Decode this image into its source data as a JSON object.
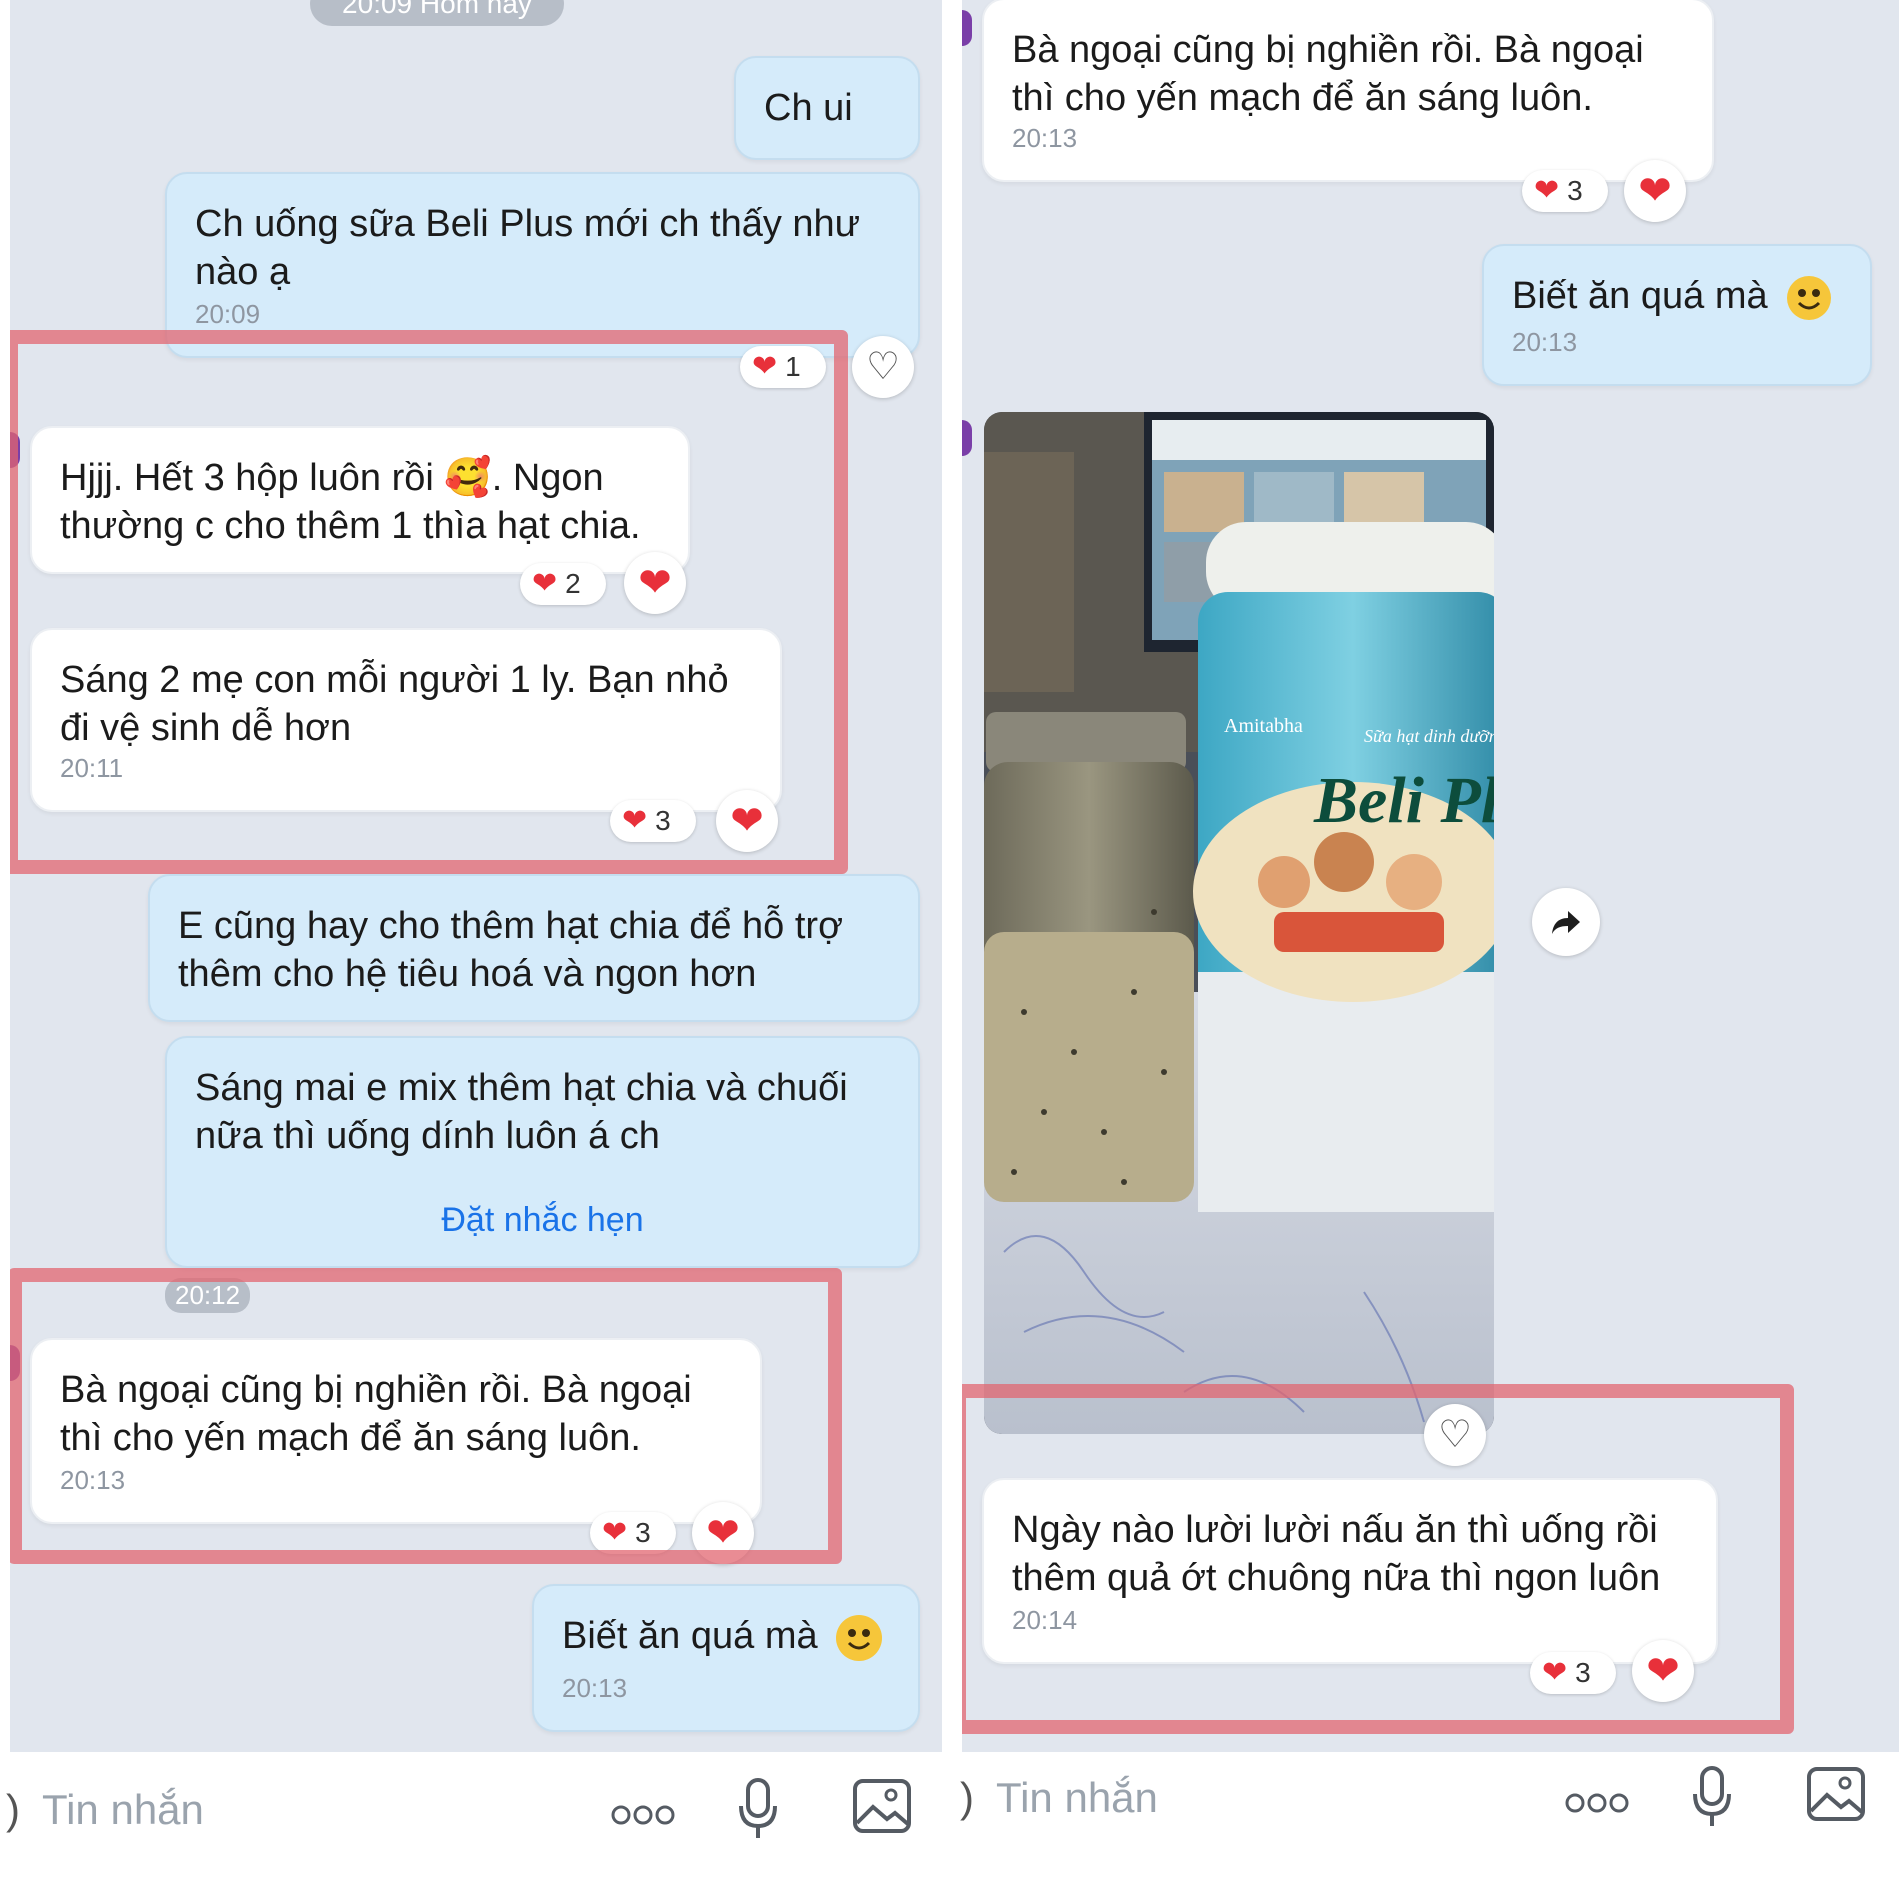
{
  "left": {
    "date_divider": "20:09 Hôm nay",
    "messages": [
      {
        "text": "Ch ui"
      },
      {
        "text": "Ch uống sữa Beli Plus mới ch thấy như nào ạ",
        "time": "20:09",
        "reaction_count": "1"
      },
      {
        "text": "Hjjj. Hết 3 hộp luôn rồi 🥰. Ngon thường c cho thêm 1 thìa hạt chia.",
        "reaction_count": "2"
      },
      {
        "text": "Sáng 2 mẹ con mỗi người 1 ly. Bạn nhỏ đi vệ sinh dễ hơn",
        "time": "20:11",
        "reaction_count": "3"
      },
      {
        "text": "E cũng hay cho thêm hạt chia để hỗ trợ thêm cho hệ tiêu hoá và ngon hơn"
      },
      {
        "text": "Sáng mai e mix thêm hạt chia và chuối nữa thì uống dính luôn á ch",
        "action": "Đặt nhắc hẹn"
      },
      {
        "time_pill": "20:12"
      },
      {
        "text": "Bà ngoại cũng bị nghiền rồi. Bà ngoại thì cho yến mạch để ăn sáng luôn.",
        "time": "20:13",
        "reaction_count": "3"
      },
      {
        "text": "Biết ăn quá mà",
        "time": "20:13"
      }
    ],
    "input_placeholder": "Tin nhắn"
  },
  "right": {
    "messages": [
      {
        "text": "Bà ngoại cũng bị nghiền rồi. Bà ngoại thì cho yến mạch để ăn sáng luôn.",
        "time": "20:13",
        "reaction_count": "3"
      },
      {
        "text": "Biết ăn quá mà",
        "time": "20:13"
      },
      {
        "photo_label_brand": "Beli Plus",
        "photo_label_top": "Sữa hạt dinh dưỡng",
        "photo_label_maker": "Amitabha"
      },
      {
        "text": "Ngày nào lười lười nấu ăn thì uống rồi thêm quả ớt chuông nữa thì ngon luôn",
        "time": "20:14",
        "reaction_count": "3"
      }
    ],
    "input_placeholder": "Tin nhắn"
  },
  "colors": {
    "outgoing_bubble": "#d5ebfa",
    "incoming_bubble": "#ffffff",
    "highlight": "#e26670",
    "heart": "#e8303a",
    "link": "#1a73e8"
  }
}
